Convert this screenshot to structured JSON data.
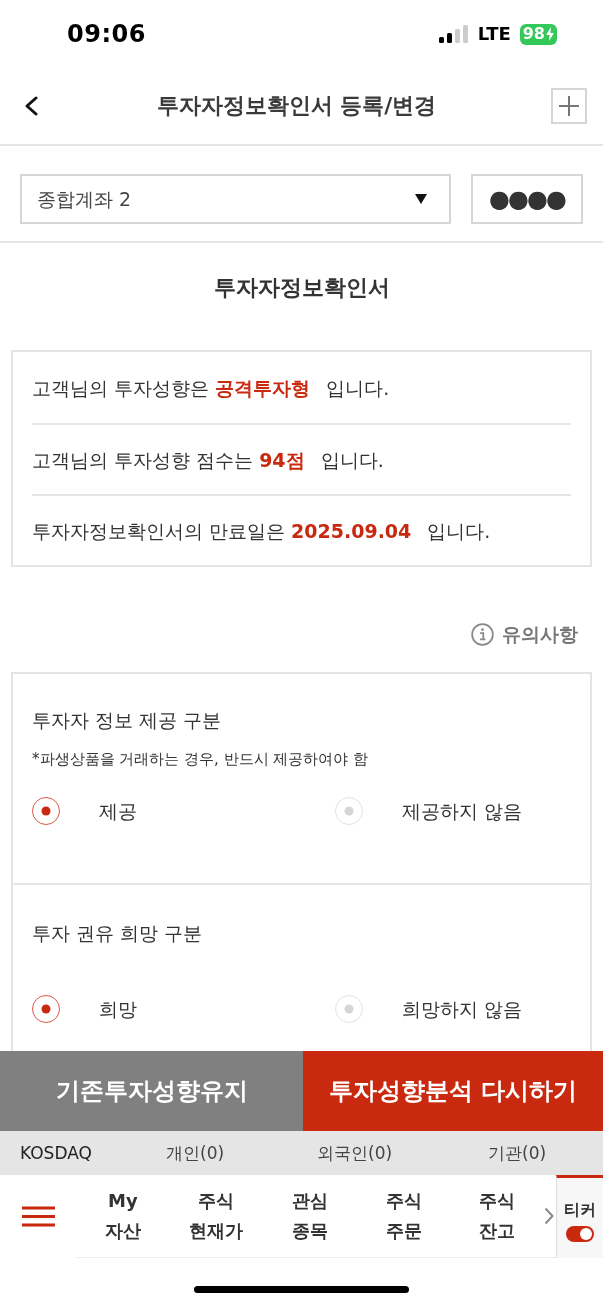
{
  "status_bar": {
    "time": "09:06",
    "network": "LTE",
    "battery": "98"
  },
  "header": {
    "title": "투자자정보확인서 등록/변경"
  },
  "account": {
    "select_value": "종합계좌 2",
    "password_mask": "●●●●"
  },
  "section_title": "투자자정보확인서",
  "summary": [
    {
      "prefix": "고객님의 투자성향은",
      "value": "공격투자형",
      "suffix": "입니다."
    },
    {
      "prefix": "고객님의 투자성향 점수는",
      "value": "94점",
      "suffix": "입니다."
    },
    {
      "prefix": "투자자정보확인서의 만료일은",
      "value": "2025.09.04",
      "suffix": "입니다."
    }
  ],
  "notice_link": {
    "label": "유의사항"
  },
  "form": {
    "sections": [
      {
        "title": "투자자 정보 제공 구분",
        "note": "*파생상품을 거래하는 경우, 반드시 제공하여야 함",
        "options": [
          {
            "label": "제공",
            "selected": true
          },
          {
            "label": "제공하지 않음",
            "selected": false
          }
        ]
      },
      {
        "title": "투자 권유 희망 구분",
        "options": [
          {
            "label": "희망",
            "selected": true
          },
          {
            "label": "희망하지 않음",
            "selected": false
          }
        ]
      }
    ]
  },
  "actions": [
    {
      "label": "기존투자성향유지",
      "kind": "secondary"
    },
    {
      "label": "투자성향분석 다시하기",
      "kind": "primary"
    }
  ],
  "ticker": {
    "market": "KOSDAQ",
    "items": [
      "개인(0)",
      "외국인(0)",
      "기관(0)"
    ]
  },
  "bottom_nav": {
    "items": [
      {
        "lines": [
          "My",
          "자산"
        ]
      },
      {
        "lines": [
          "주식",
          "현재가"
        ]
      },
      {
        "lines": [
          "관심",
          "종목"
        ]
      },
      {
        "lines": [
          "주식",
          "주문"
        ]
      },
      {
        "lines": [
          "주식",
          "잔고"
        ]
      }
    ]
  },
  "ticker_toggle": {
    "label": "티커",
    "on": true
  }
}
